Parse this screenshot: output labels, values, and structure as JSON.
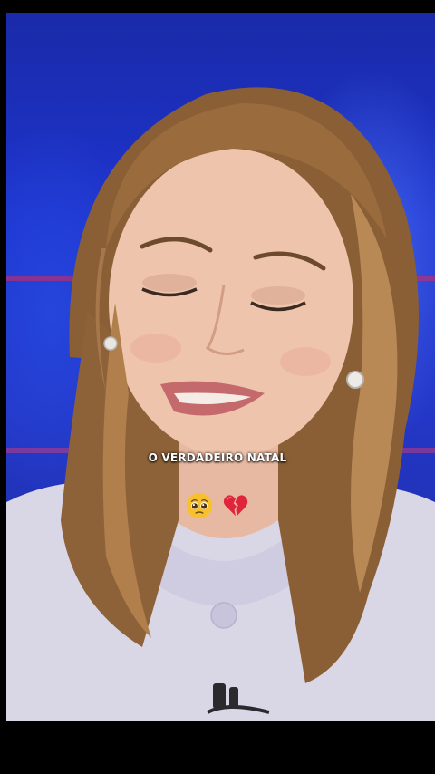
{
  "video": {
    "caption": "O VERDADEIRO NATAL",
    "emojis": [
      "pleading-face",
      "broken-heart"
    ]
  }
}
